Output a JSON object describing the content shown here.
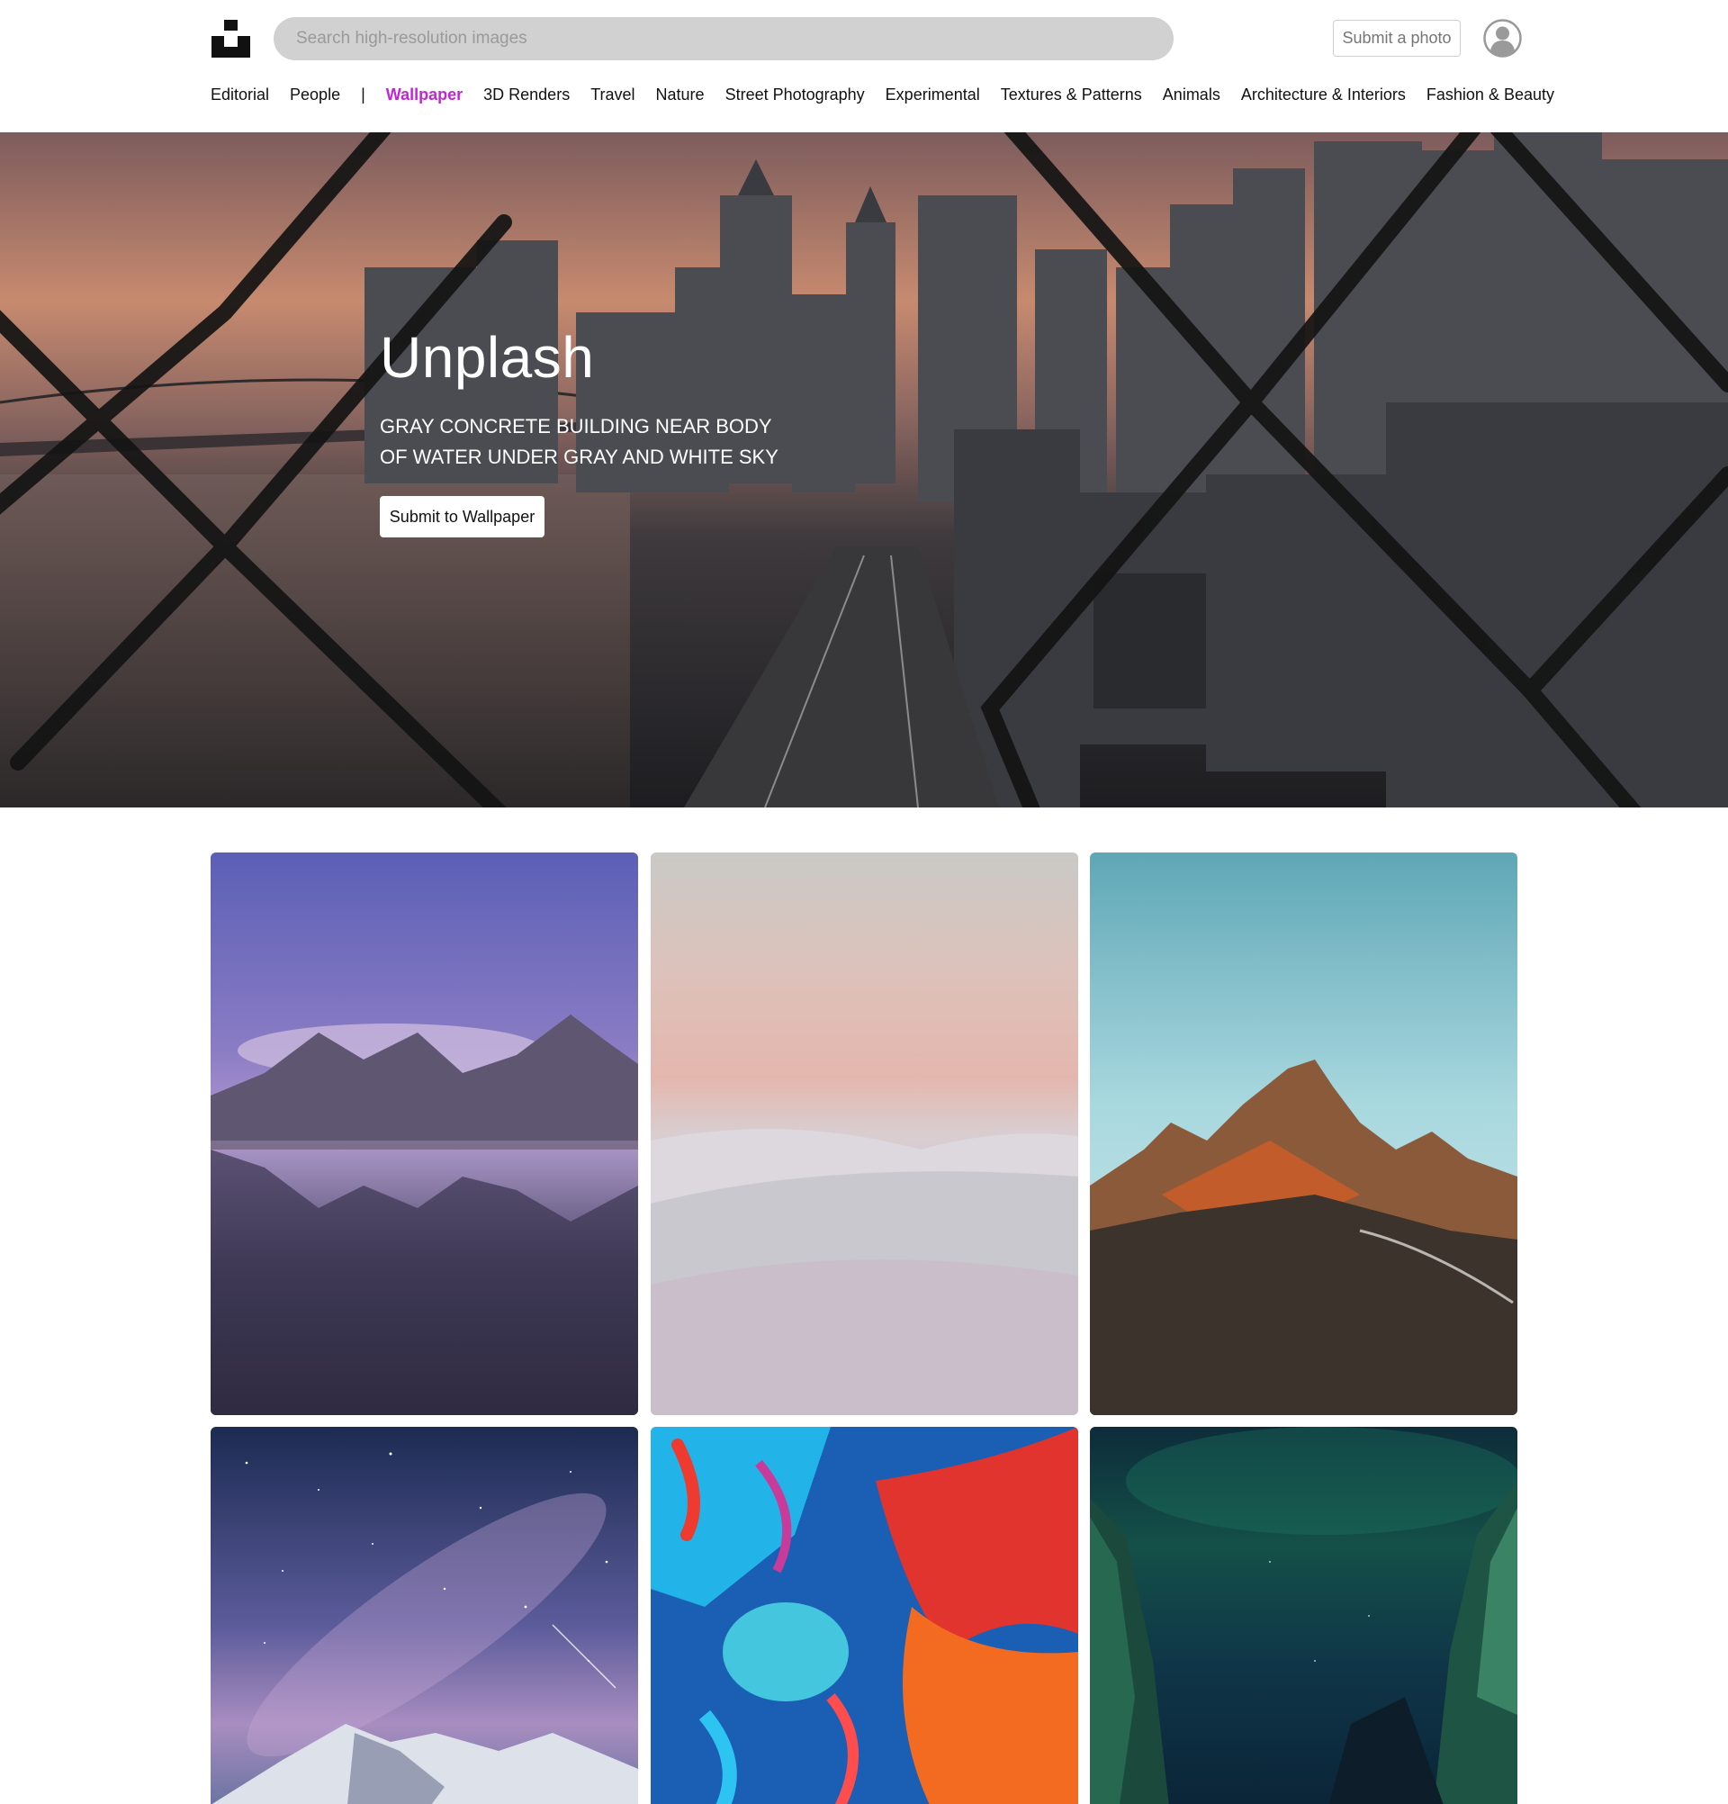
{
  "header": {
    "logo": "unsplash-logo-icon",
    "search_placeholder": "Search high-resolution images",
    "submit_photo_label": "Submit a photo",
    "avatar": "user-avatar-icon"
  },
  "nav": {
    "items": [
      {
        "label": "Editorial"
      },
      {
        "label": "People"
      },
      {
        "label": "|"
      },
      {
        "label": "Wallpaper",
        "active": true
      },
      {
        "label": "3D Renders"
      },
      {
        "label": "Travel"
      },
      {
        "label": "Nature"
      },
      {
        "label": "Street Photography"
      },
      {
        "label": "Experimental"
      },
      {
        "label": "Textures & Patterns"
      },
      {
        "label": "Animals"
      },
      {
        "label": "Architecture & Interiors"
      },
      {
        "label": "Fashion & Beauty"
      }
    ],
    "active_color": "#c026d3"
  },
  "hero": {
    "title": "Unplash",
    "subtitle": "GRAY CONCRETE BUILDING NEAR BODY OF WATER UNDER GRAY AND WHITE SKY",
    "button_label": "Submit to Wallpaper"
  },
  "gallery": {
    "photos": [
      {
        "subject": "mountain-lake-reflection"
      },
      {
        "subject": "pink-desert-dunes"
      },
      {
        "subject": "sunlit-mountain-peak"
      },
      {
        "subject": "starry-sky-snow-mountain"
      },
      {
        "subject": "colorful-ink-smoke"
      },
      {
        "subject": "aurora-cliffs-night"
      }
    ]
  }
}
